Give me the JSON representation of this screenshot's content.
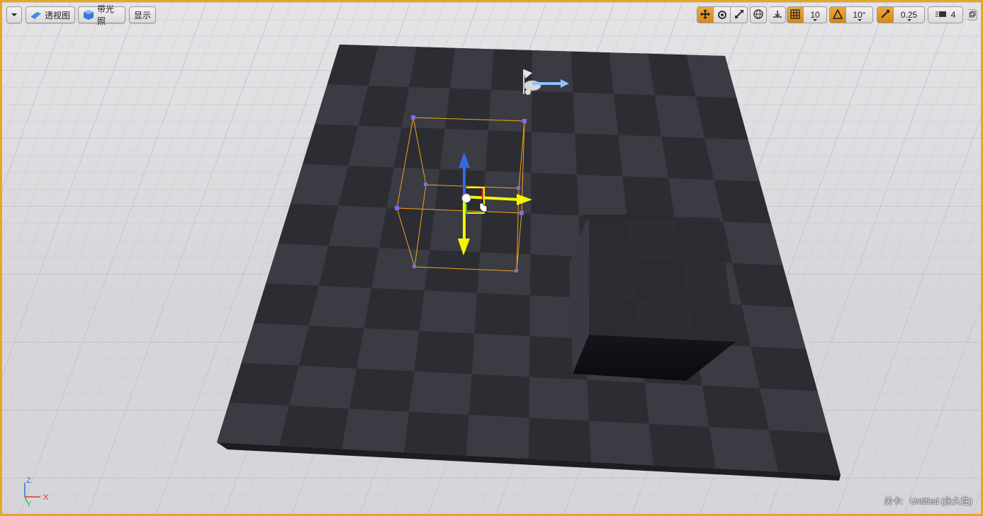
{
  "toolbar": {
    "menu_icon": "chevron-down-icon",
    "perspective_label": "透视图",
    "lit_label": "带光照",
    "show_label": "显示",
    "grid_snap_value": "10",
    "rotation_snap_value": "10°",
    "scale_snap_value": "0.25",
    "camera_speed_value": "4"
  },
  "status": {
    "level_label": "关卡:",
    "level_name": "Untitled (永久性)"
  },
  "axis": {
    "x_label": "X",
    "y_label": "Y",
    "z_label": "Z"
  },
  "colors": {
    "selection_border": "#e7a528",
    "active_toggle": "#e39a2a",
    "gizmo_x": "#f5f500",
    "gizmo_y": "#f5f500",
    "gizmo_z": "#2f6de0",
    "floor_dark": "#2c2c33",
    "floor_light": "#3b3b44"
  }
}
